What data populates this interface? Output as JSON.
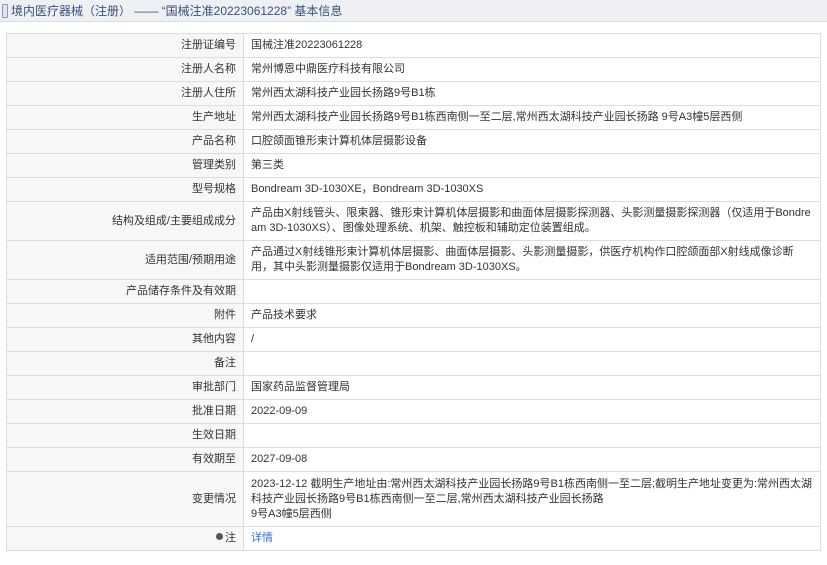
{
  "header": {
    "title": "境内医疗器械（注册） —— “国械注准20223061228” 基本信息"
  },
  "rows": [
    {
      "label": "注册证编号",
      "value": "国械注准20223061228"
    },
    {
      "label": "注册人名称",
      "value": "常州博恩中鼎医疗科技有限公司"
    },
    {
      "label": "注册人住所",
      "value": "常州西太湖科技产业园长扬路9号B1栋"
    },
    {
      "label": "生产地址",
      "value": "常州西太湖科技产业园长扬路9号B1栋西南侧一至二层,常州西太湖科技产业园长扬路 9号A3幢5层西侧"
    },
    {
      "label": "产品名称",
      "value": "口腔颌面锥形束计算机体层摄影设备"
    },
    {
      "label": "管理类别",
      "value": "第三类"
    },
    {
      "label": "型号规格",
      "value": "Bondream 3D-1030XE，Bondream 3D-1030XS"
    },
    {
      "label": "结构及组成/主要组成成分",
      "value": "产品由X射线管头、限束器、锥形束计算机体层摄影和曲面体层摄影探测器、头影测量摄影探测器（仅适用于Bondream 3D-1030XS）、图像处理系统、机架、触控板和辅助定位装置组成。"
    },
    {
      "label": "适用范围/预期用途",
      "value": "产品通过X射线锥形束计算机体层摄影、曲面体层摄影、头影测量摄影，供医疗机构作口腔颌面部X射线成像诊断用，其中头影测量摄影仅适用于Bondream 3D-1030XS。"
    },
    {
      "label": "产品储存条件及有效期",
      "value": ""
    },
    {
      "label": "附件",
      "value": "产品技术要求"
    },
    {
      "label": "其他内容",
      "value": "/"
    },
    {
      "label": "备注",
      "value": ""
    },
    {
      "label": "审批部门",
      "value": "国家药品监督管理局"
    },
    {
      "label": "批准日期",
      "value": "2022-09-09"
    },
    {
      "label": "生效日期",
      "value": ""
    },
    {
      "label": "有效期至",
      "value": "2027-09-08"
    },
    {
      "label": "变更情况",
      "value_line1": "2023-12-12 截明生产地址由:常州西太湖科技产业园长扬路9号B1栋西南侧一至二层;截明生产地址变更为:常州西太湖科技产业园长扬路9号B1栋西南侧一至二层,常州西太湖科技产业园长扬路",
      "value_line2": "9号A3幢5层西侧"
    },
    {
      "label": "注",
      "link": "详情"
    }
  ]
}
